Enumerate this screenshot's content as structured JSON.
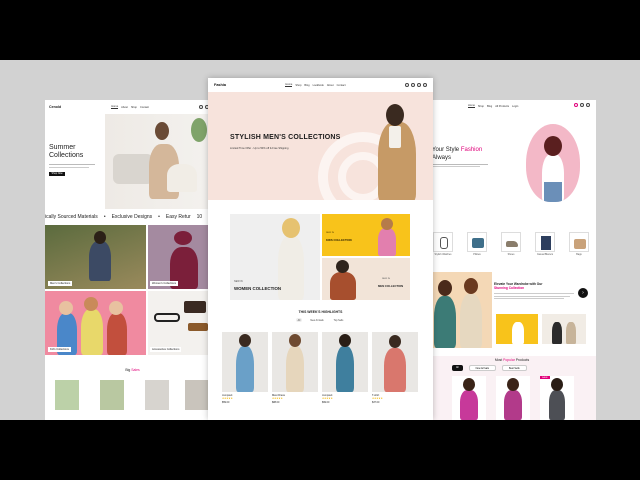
{
  "left": {
    "logo": "Cenold",
    "nav": [
      "Home",
      "About",
      "Shop",
      "Contact"
    ],
    "hero_title_1": "Summer",
    "hero_title_2": "Collections",
    "hero_button": "Shop Now",
    "ticker": [
      "ically Sourced Materials",
      "Exclusive Designs",
      "Easy Retur",
      "10"
    ],
    "tiles": [
      "Men's Collections",
      "Women's Collections",
      "Kid's Collections",
      "Accessories Collections"
    ],
    "big_sales_prefix": "Big",
    "big_sales_accent": "Sales"
  },
  "center": {
    "logo": "Fashia",
    "nav": [
      "Home",
      "Shop",
      "Blog",
      "Lookbook",
      "About",
      "Contact"
    ],
    "hero_title": "STYLISH MEN'S COLLECTIONS",
    "hero_sub": "Limited Time Offer - Up to 50% off & Free Shipping",
    "banner_women": "WOMEN COLLECTION",
    "banner_women_tag": "NEW IN",
    "banner_kids": "KIDS COLLECTION",
    "banner_kids_tag": "NEW IN",
    "banner_men": "MEN COLLECTION",
    "banner_men_tag": "NEW IN",
    "section_title": "THIS WEEK'S HIGHLIGHTS",
    "tabs": [
      "All",
      "New Arrivals",
      "Top Sells"
    ],
    "products": [
      {
        "name": "Jumpsuit",
        "price": "$59.00"
      },
      {
        "name": "Maxi Dress",
        "price": "$88.00"
      },
      {
        "name": "Jumpsuit",
        "price": "$99.00"
      },
      {
        "name": "T-shirt",
        "price": "$37.00"
      }
    ],
    "stars": "★★★★★"
  },
  "right": {
    "nav": [
      "Home",
      "Shop",
      "Blog",
      "All Products",
      "Login"
    ],
    "hero_line1_prefix": "Your Style",
    "hero_line1_accent": "Fashion",
    "hero_line2": "Always",
    "categories": [
      "Stylish Watches",
      "Pillows",
      "Shoes",
      "Casual Blazers",
      "Bags"
    ],
    "promo_title": "Elevate Your Wardrobe with Our",
    "promo_accent": "Stunning Collection",
    "popular_prefix": "Most",
    "popular_accent": "Popular",
    "popular_suffix": "Products",
    "popular_tabs": [
      "All",
      "New Arrivals",
      "Best Sells"
    ],
    "sale_badge": "SALE"
  },
  "colors": {
    "accent_pink": "#e0007a",
    "center_hero_bg": "#f7e3dc",
    "yellow_banner": "#f8c31b",
    "tile_pink": "#f08aa0"
  }
}
